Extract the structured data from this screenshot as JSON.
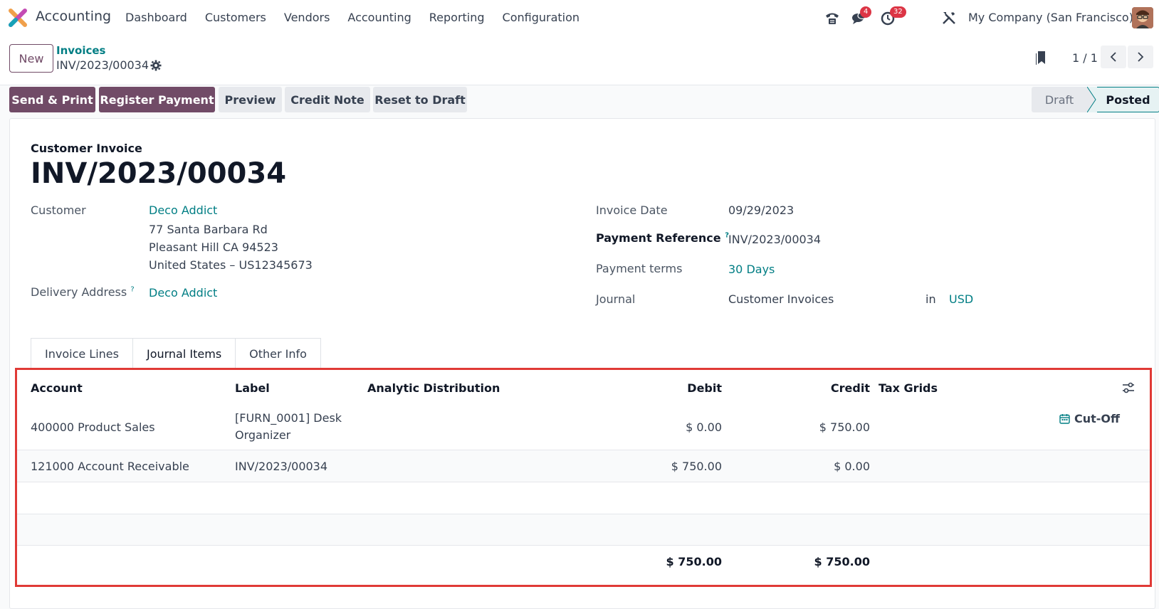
{
  "navbar": {
    "app_name": "Accounting",
    "menu": [
      "Dashboard",
      "Customers",
      "Vendors",
      "Accounting",
      "Reporting",
      "Configuration"
    ],
    "messages_badge": "4",
    "activities_badge": "32",
    "company": "My Company (San Francisco)"
  },
  "control_panel": {
    "new_label": "New",
    "breadcrumb_parent": "Invoices",
    "breadcrumb_current": "INV/2023/00034",
    "pager": "1 / 1"
  },
  "actions": {
    "send_print": "Send & Print",
    "register_payment": "Register Payment",
    "preview": "Preview",
    "credit_note": "Credit Note",
    "reset_to_draft": "Reset to Draft"
  },
  "statusbar": {
    "stages": [
      "Draft",
      "Posted"
    ],
    "current": "Posted"
  },
  "invoice": {
    "type": "Customer Invoice",
    "name": "INV/2023/00034",
    "customer_label": "Customer",
    "customer": "Deco Addict",
    "address_line1": "77 Santa Barbara Rd",
    "address_line2": "Pleasant Hill CA 94523",
    "address_line3": "United States – US12345673",
    "delivery_label": "Delivery Address",
    "delivery": "Deco Addict",
    "invoice_date_label": "Invoice Date",
    "invoice_date": "09/29/2023",
    "payment_ref_label": "Payment Reference",
    "payment_ref": "INV/2023/00034",
    "payment_terms_label": "Payment terms",
    "payment_terms": "30 Days",
    "journal_label": "Journal",
    "journal": "Customer Invoices",
    "in_label": "in",
    "currency": "USD"
  },
  "tabs": [
    "Invoice Lines",
    "Journal Items",
    "Other Info"
  ],
  "journal_items": {
    "headers": {
      "account": "Account",
      "label": "Label",
      "analytic": "Analytic Distribution",
      "debit": "Debit",
      "credit": "Credit",
      "tax_grids": "Tax Grids"
    },
    "rows": [
      {
        "account": "400000 Product Sales",
        "label_line1": "[FURN_0001] Desk",
        "label_line2": "Organizer",
        "debit": "$ 0.00",
        "credit": "$ 750.00",
        "action": "Cut-Off"
      },
      {
        "account": "121000 Account Receivable",
        "label_line1": "INV/2023/00034",
        "label_line2": "",
        "debit": "$ 750.00",
        "credit": "$ 0.00",
        "action": ""
      }
    ],
    "total_debit": "$ 750.00",
    "total_credit": "$ 750.00"
  },
  "colors": {
    "primary": "#714b67",
    "link": "#017e84",
    "highlight_border": "#e03a36"
  }
}
